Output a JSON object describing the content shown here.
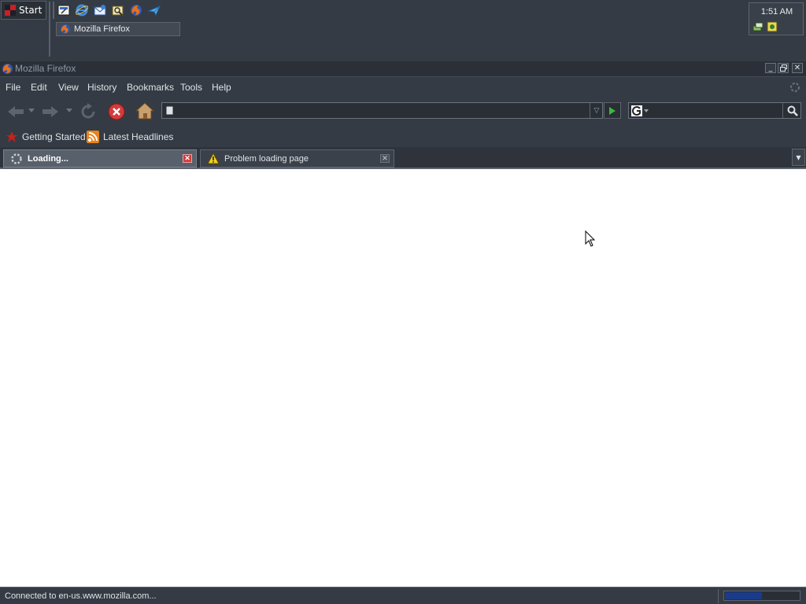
{
  "taskbar": {
    "start_label": "Start",
    "quick_launch": [
      "show-desktop-icon",
      "internet-explorer-icon",
      "outlook-icon",
      "address-book-icon",
      "firefox-icon",
      "messenger-icon"
    ],
    "task_button_label": "Mozilla Firefox",
    "clock": "1:51 AM"
  },
  "window": {
    "title": "Mozilla Firefox"
  },
  "menu": {
    "file": "File",
    "edit": "Edit",
    "view": "View",
    "history": "History",
    "bookmarks": "Bookmarks",
    "tools": "Tools",
    "help": "Help"
  },
  "navigation": {
    "url_value": "",
    "search_value": ""
  },
  "bookmarks_toolbar": {
    "items": [
      {
        "label": "Getting Started",
        "icon": "getting-started-icon"
      },
      {
        "label": "Latest Headlines",
        "icon": "rss-feed-icon"
      }
    ]
  },
  "tabs": [
    {
      "label": "Loading...",
      "icon": "loading-throbber-icon",
      "active": true
    },
    {
      "label": "Problem loading page",
      "icon": "warning-icon",
      "active": false
    }
  ],
  "status": {
    "text": "Connected to en-us.www.mozilla.com...",
    "progress": 0.5
  },
  "colors": {
    "chrome": "#353b44",
    "titlebar": "#2b3038",
    "active_tab": "#58606b",
    "tab_close_active": "#d43a3a",
    "progress_fill": "#1a3a8a"
  }
}
